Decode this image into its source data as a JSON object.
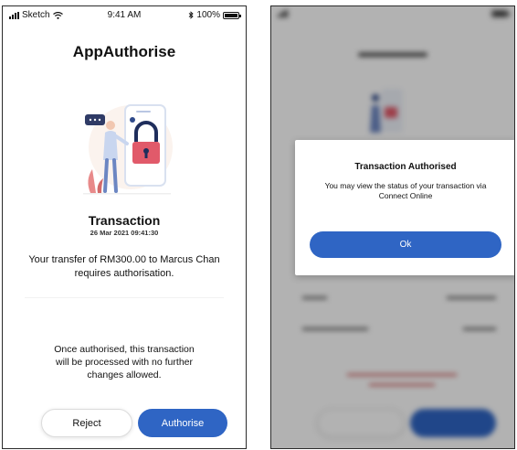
{
  "status_bar": {
    "carrier": "Sketch",
    "time": "9:41 AM",
    "battery": "100%"
  },
  "screen1": {
    "app_title": "AppAuthorise",
    "transaction_title": "Transaction",
    "transaction_date": "26 Mar 2021 09:41:30",
    "message": "Your transfer of RM300.00 to Marcus Chan requires authorisation.",
    "note": "Once authorised, this transaction will be processed with no further changes allowed.",
    "reject_label": "Reject",
    "authorise_label": "Authorise"
  },
  "screen2": {
    "dialog_title": "Transaction Authorised",
    "dialog_message": "You may view the status of your transaction via Connect Online",
    "ok_label": "Ok"
  },
  "colors": {
    "primary": "#2f65c4",
    "text": "#111111",
    "border": "#2b2b2b"
  }
}
